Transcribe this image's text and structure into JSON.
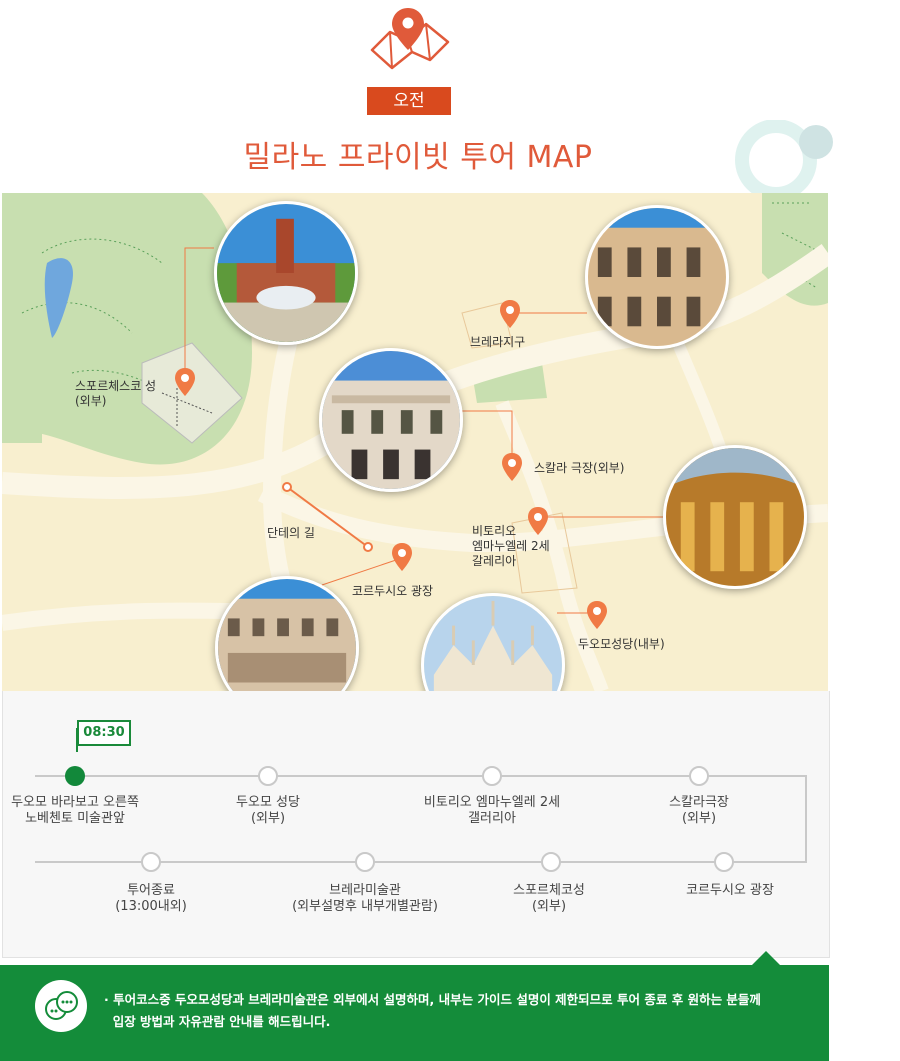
{
  "header": {
    "badge": "오전",
    "title": "밀라노 프라이빗 투어 MAP",
    "icon": "map-pin-icon"
  },
  "map": {
    "places": [
      {
        "id": "sforzesco",
        "label": "스포르체스코 성\n(외부)"
      },
      {
        "id": "brera",
        "label": "브레라지구"
      },
      {
        "id": "scala",
        "label": "스칼라 극장(외부)"
      },
      {
        "id": "dante",
        "label": "단테의 길"
      },
      {
        "id": "galleria",
        "label": "비토리오\n엠마누엘레 2세\n갈레리아"
      },
      {
        "id": "cordusio",
        "label": "코르두시오 광장"
      },
      {
        "id": "duomo",
        "label": "두오모성당(내부)"
      }
    ],
    "colors": {
      "pin": "#f07a45",
      "park": "#c8dfb0",
      "road": "#fbf6e6",
      "water": "#6fa7dd"
    }
  },
  "timeline": {
    "start_time": "08:30",
    "stops": [
      {
        "label": "두오모 바라보고 오른쪽\n노베첸토 미술관앞",
        "active": true
      },
      {
        "label": "두오모 성당\n(외부)",
        "active": false
      },
      {
        "label": "비토리오 엠마누엘레 2세\n갤러리아",
        "active": false
      },
      {
        "label": "스칼라극장\n(외부)",
        "active": false
      },
      {
        "label": "코르두시오 광장",
        "active": false
      },
      {
        "label": "스포르체코성\n(외부)",
        "active": false
      },
      {
        "label": "브레라미술관\n(외부설명후 내부개별관람)",
        "active": false
      },
      {
        "label": "투어종료\n(13:00내외)",
        "active": false
      }
    ],
    "colors": {
      "active": "#12883a",
      "line": "#c9c9c9"
    }
  },
  "note": {
    "icon": "chat-bubble-icon",
    "text": "· 투어코스중 두오모성당과 브레라미술관은 외부에서 설명하며, 내부는 가이드 설명이 제한되므로 투어 종료 후 원하는 분들께\n  입장 방법과 자유관람 안내를 해드립니다."
  }
}
